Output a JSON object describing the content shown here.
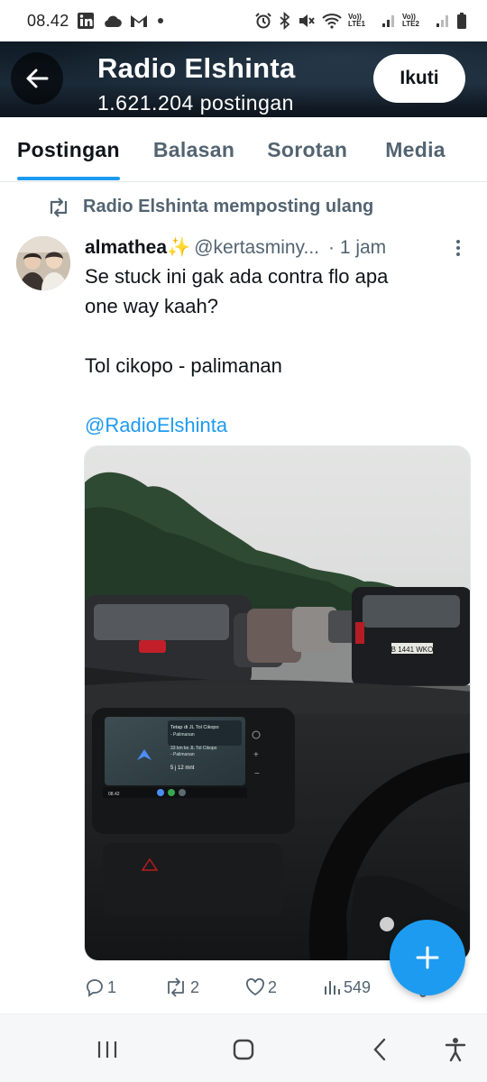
{
  "status_bar": {
    "time": "08.42",
    "icons": [
      "linkedin-icon",
      "cloud-icon",
      "gmail-icon",
      "dot-icon",
      "alarm-icon",
      "bluetooth-icon",
      "mute-icon",
      "wifi-icon",
      "signal-icon",
      "battery-icon"
    ],
    "sim1_label": "Vo)) LTE1",
    "sim2_label": "Vo)) LTE2"
  },
  "header": {
    "title": "Radio Elshinta",
    "subtitle": "1.621.204 postingan",
    "follow_label": "Ikuti",
    "accent": "#1d9bf0"
  },
  "tabs": [
    {
      "label": "Postingan",
      "active": true
    },
    {
      "label": "Balasan",
      "active": false
    },
    {
      "label": "Sorotan",
      "active": false
    },
    {
      "label": "Media",
      "active": false
    }
  ],
  "repost": {
    "text": "Radio Elshinta memposting ulang"
  },
  "tweet": {
    "author_name": "almathea",
    "author_emoji": "✨",
    "handle": "@kertasminy...",
    "time": "· 1 jam",
    "text_line1": "Se stuck ini gak ada contra flo apa",
    "text_line2": "one way kaah?",
    "text_line3": "Tol cikopo - palimanan",
    "mention": "@RadioElshinta",
    "media": {
      "nav_text_1": "Tetap di JL Tol Cikopo",
      "nav_text_2": "- Palimanan",
      "nav_text_3": "33 km ke JL Tol Cikopo",
      "nav_text_4": "- Palimanan",
      "nav_eta": "5 j 12 mnt",
      "nav_distance": "33 km",
      "nav_clock": "08.42",
      "plate_text": "B 1441 WKO"
    },
    "stats": {
      "replies": "1",
      "reposts": "2",
      "likes": "2",
      "views": "549"
    }
  },
  "colors": {
    "primary_text": "#0f1419",
    "secondary_text": "#536471",
    "link": "#1d9bf0",
    "fab": "#1d9bf0"
  }
}
